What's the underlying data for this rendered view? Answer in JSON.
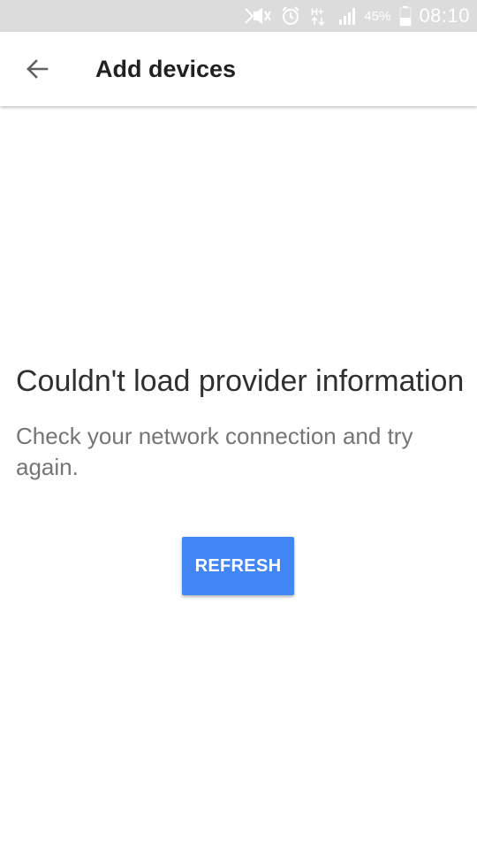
{
  "status_bar": {
    "icons": [
      "mute-icon",
      "alarm-icon",
      "network-hplus-icon",
      "signal-icon",
      "battery-icon"
    ],
    "network_label": "H+",
    "battery_percent": "45%",
    "battery_level": 0.45,
    "time": "08:10"
  },
  "app_bar": {
    "back_icon": "arrow-back-icon",
    "title": "Add devices"
  },
  "main": {
    "error_title": "Couldn't load provider information",
    "error_message": "Check your network connection and try again.",
    "refresh_label": "REFRESH"
  },
  "colors": {
    "status_bar_bg": "#dcdcdc",
    "accent": "#4285f4",
    "title_text": "#212121",
    "body_text": "#757575"
  }
}
